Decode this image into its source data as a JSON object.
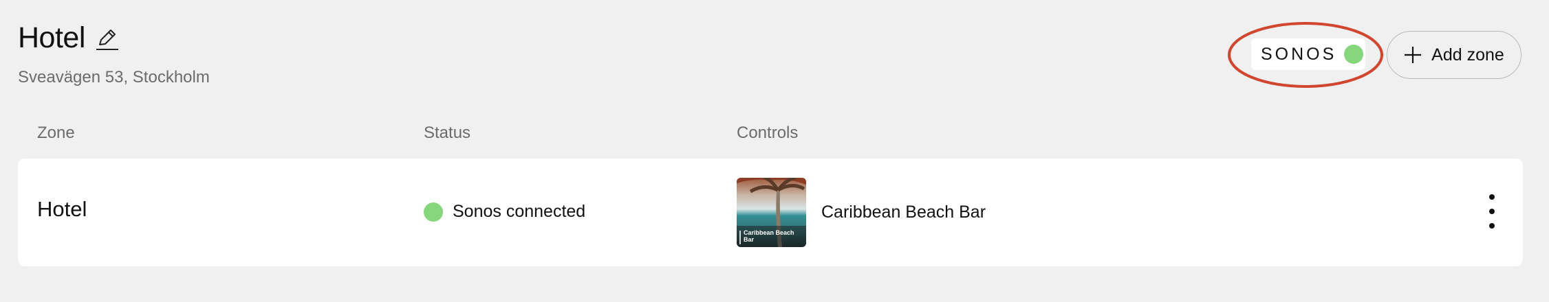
{
  "header": {
    "title": "Hotel",
    "address": "Sveavägen 53, Stockholm"
  },
  "sonos": {
    "logo_text": "SONOS",
    "status_color": "#86d67d",
    "highlight_color": "#d0462f"
  },
  "actions": {
    "add_zone_label": "Add zone"
  },
  "table": {
    "columns": [
      "Zone",
      "Status",
      "Controls"
    ],
    "rows": [
      {
        "zone": "Hotel",
        "status": "Sonos connected",
        "status_color": "#86d67d",
        "playlist": "Caribbean Beach Bar",
        "thumb_caption": "Caribbean Beach Bar"
      }
    ]
  },
  "icons": {
    "edit": "pencil-icon",
    "add": "plus-icon",
    "more": "more-vertical-icon",
    "status": "status-dot-icon"
  }
}
